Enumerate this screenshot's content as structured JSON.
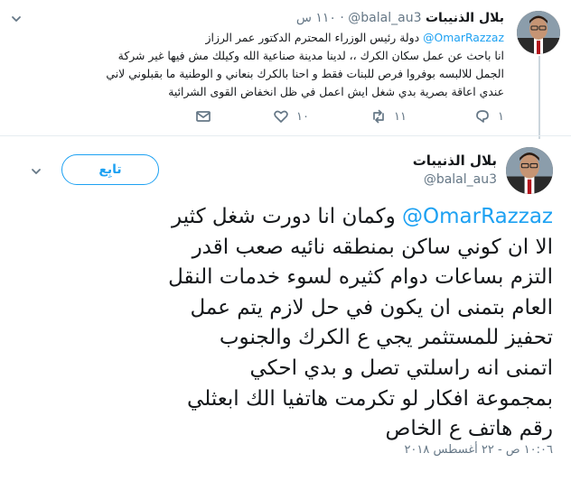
{
  "reply": {
    "author_name": "بلال الذنيبات",
    "handle": "@balal_au3",
    "separator": "·",
    "time": "١١٠ س",
    "mention": "@OmarRazzaz",
    "text_line1_rest": " دولة رئيس الوزراء المحترم الدكتور عمر الرزاز",
    "text_line2": "انا باحث عن عمل سكان الكرك ،، لدينا مدينة صناعية الله وكيلك مش فيها غير شركة",
    "text_line3": "الجمل للالبسه بوفروا فرص للبنات فقط و احنا بالكرك بنعاني و الوطنية ما بقبلوني لاني",
    "text_line4": "عندي اعاقة بصرية بدي شغل ايش اعمل في ظل انخفاض القوى الشرائية",
    "reply_count": "١",
    "retweet_count": "١١",
    "like_count": "١٠"
  },
  "tweet": {
    "author_name": "بلال الذنيبات",
    "handle": "@balal_au3",
    "follow_label": "تابِع",
    "mention": "@OmarRazzaz",
    "line1_rest": " وكمان انا دورت شغل كثير",
    "line2": "الا ان كوني ساكن بمنطقه نائيه صعب اقدر",
    "line3": "التزم بساعات دوام كثيره لسوء خدمات النقل",
    "line4": "العام بتمنى ان يكون في حل لازم يتم عمل",
    "line5": "تحفيز للمستثمر يجي ع الكرك والجنوب",
    "line6": "اتمنى انه راسلتي تصل و بدي احكي",
    "line7": "بمجموعة افكار لو تكرمت هاتفيا الك ابعثلي",
    "line8": "رقم هاتف ع الخاص",
    "timestamp": "١٠:٠٦ ص - ٢٢ أغسطس ٢٠١٨"
  },
  "icons": {
    "more": "chevron-down-icon",
    "reply": "reply-icon",
    "retweet": "retweet-icon",
    "like": "heart-icon",
    "dm": "envelope-icon"
  },
  "colors": {
    "accent": "#1da1f2",
    "secondary_text": "#657786",
    "border": "#e6ecf0"
  }
}
